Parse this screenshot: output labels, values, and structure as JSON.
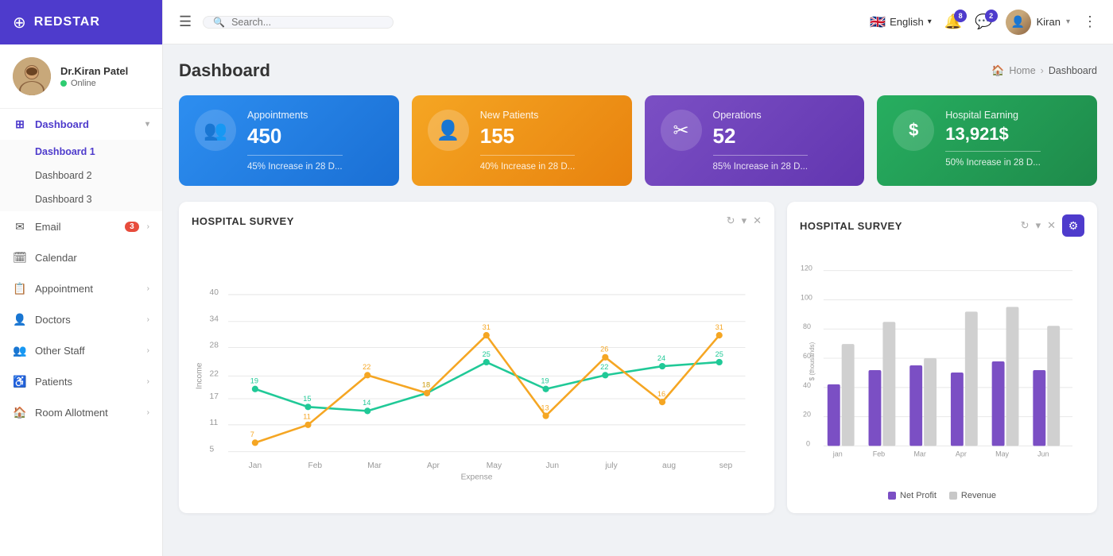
{
  "sidebar": {
    "logo": "REDSTAR",
    "user": {
      "name": "Dr.Kiran Patel",
      "status": "Online"
    },
    "nav": [
      {
        "id": "dashboard",
        "icon": "⊞",
        "label": "Dashboard",
        "active": true,
        "expanded": true,
        "children": [
          {
            "id": "dashboard1",
            "label": "Dashboard 1",
            "active": true
          },
          {
            "id": "dashboard2",
            "label": "Dashboard 2",
            "active": false
          },
          {
            "id": "dashboard3",
            "label": "Dashboard 3",
            "active": false
          }
        ]
      },
      {
        "id": "email",
        "icon": "✉",
        "label": "Email",
        "badge": "3",
        "arrow": "›"
      },
      {
        "id": "calendar",
        "icon": "📅",
        "label": "Calendar",
        "arrow": null
      },
      {
        "id": "appointment",
        "icon": "📋",
        "label": "Appointment",
        "arrow": "›"
      },
      {
        "id": "doctors",
        "icon": "👤",
        "label": "Doctors",
        "arrow": "›"
      },
      {
        "id": "other-staff",
        "icon": "👥",
        "label": "Other Staff",
        "arrow": "›"
      },
      {
        "id": "patients",
        "icon": "♿",
        "label": "Patients",
        "arrow": "›"
      },
      {
        "id": "room-allotment",
        "icon": "🏠",
        "label": "Room Allotment",
        "arrow": "›"
      }
    ]
  },
  "header": {
    "search_placeholder": "Search...",
    "language": "English",
    "notification_count": "8",
    "message_count": "2",
    "user_name": "Kiran"
  },
  "page": {
    "title": "Dashboard",
    "breadcrumb_home": "Home",
    "breadcrumb_current": "Dashboard"
  },
  "stat_cards": [
    {
      "id": "appointments",
      "color": "blue",
      "icon": "👥",
      "title": "Appointments",
      "value": "450",
      "sub": "45% Increase in 28 D..."
    },
    {
      "id": "new-patients",
      "color": "orange",
      "icon": "👤",
      "title": "New Patients",
      "value": "155",
      "sub": "40% Increase in 28 D..."
    },
    {
      "id": "operations",
      "color": "purple",
      "icon": "✂",
      "title": "Operations",
      "value": "52",
      "sub": "85% Increase in 28 D..."
    },
    {
      "id": "hospital-earning",
      "color": "green",
      "icon": "$",
      "title": "Hospital Earning",
      "value": "13,921$",
      "sub": "50% Increase in 28 D..."
    }
  ],
  "line_chart": {
    "title": "HOSPITAL SURVEY",
    "x_labels": [
      "Jan",
      "Feb",
      "Mar",
      "Apr",
      "May",
      "Jun",
      "july",
      "aug",
      "sep"
    ],
    "y_labels": [
      "5",
      "11",
      "17",
      "22",
      "28",
      "34",
      "40"
    ],
    "x_axis_label": "Expense",
    "y_axis_label": "Income",
    "series": [
      {
        "name": "teal",
        "color": "#20c997",
        "points": [
          19,
          15,
          14,
          18,
          25,
          19,
          22,
          24,
          25
        ],
        "labels": [
          "19",
          "15",
          "14",
          "18",
          "25",
          "19",
          "22",
          "24",
          "25"
        ]
      },
      {
        "name": "orange",
        "color": "#f5a623",
        "points": [
          7,
          11,
          22,
          18,
          31,
          13,
          26,
          16,
          31
        ],
        "labels": [
          "7",
          "11",
          "22",
          "18",
          "31",
          "13",
          "26",
          "16",
          "31"
        ]
      }
    ]
  },
  "bar_chart": {
    "title": "HOSPITAL SURVEY",
    "x_labels": [
      "jan",
      "Feb",
      "Mar",
      "Apr",
      "May",
      "Jun"
    ],
    "y_labels": [
      "0",
      "20",
      "40",
      "60",
      "80",
      "100",
      "120"
    ],
    "y_axis_label": "$ (thousands)",
    "legend": [
      {
        "label": "Net Profit",
        "color": "#7b4fc4"
      },
      {
        "label": "Revenue",
        "color": "#c8c8c8"
      }
    ],
    "series": [
      {
        "name": "Net Profit",
        "color": "#7b4fc4",
        "values": [
          42,
          52,
          55,
          50,
          58,
          52
        ]
      },
      {
        "name": "Revenue",
        "color": "#c8c8c8",
        "values": [
          70,
          85,
          60,
          92,
          95,
          82
        ]
      }
    ]
  }
}
